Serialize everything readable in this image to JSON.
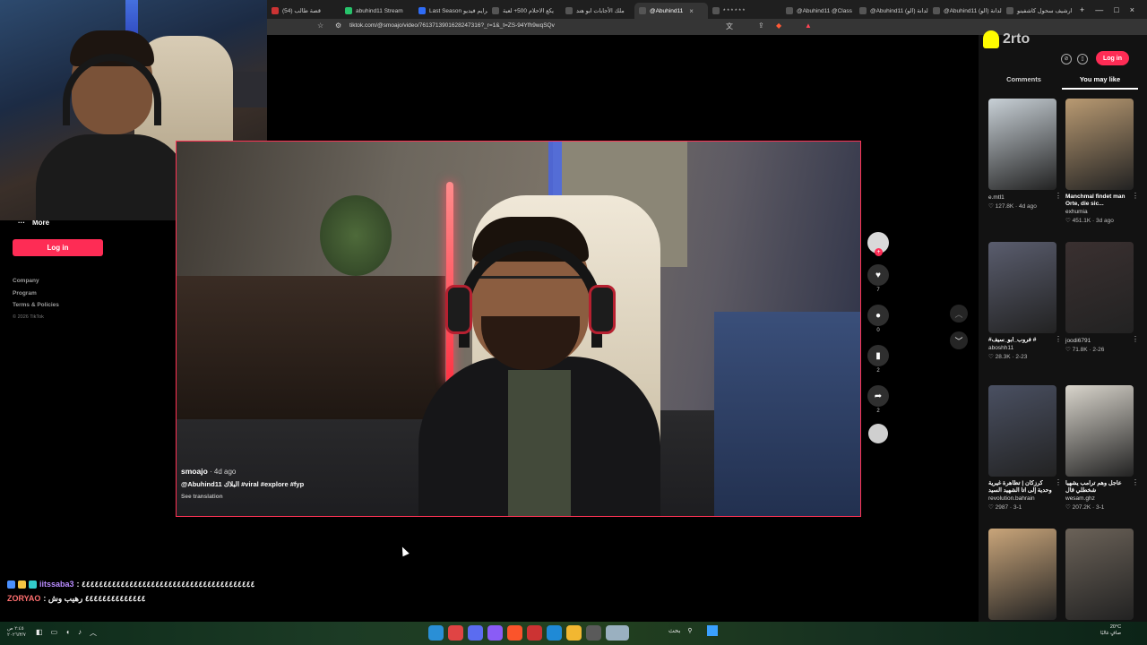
{
  "browser": {
    "tabs": [
      {
        "label": "(54) قصة طالب",
        "color": "#c33"
      },
      {
        "label": "abuhind11 Stream",
        "color": "#27c36b"
      },
      {
        "label": "Last Season برايم فيديو",
        "color": "#2f6cf6"
      },
      {
        "label": "يكع الاحلام 500+ لعبة",
        "color": "#555"
      },
      {
        "label": "ملك الأجابات ابو هند",
        "color": "#555"
      },
      {
        "label": "@Abuhind11",
        "color": "#555",
        "active": true
      },
      {
        "label": "* * * * * *",
        "color": "#555"
      },
      {
        "label": "@Abuhind11 @Class",
        "color": "#555"
      },
      {
        "label": "@Abuhind11 الدانة (الو)",
        "color": "#555"
      },
      {
        "label": "@Abuhind11 الدانة (الو)",
        "color": "#555"
      },
      {
        "label": "ارشيف سحول كاشفينو",
        "color": "#555"
      }
    ],
    "close_glyph": "×",
    "new_tab": "+",
    "window_controls": [
      "—",
      "□",
      "×"
    ],
    "url": "tiktok.com/@smoajo/video/7613713901628247316?_r=1&_t=ZS-94Yfh9wqSQv"
  },
  "sidebar": {
    "more_icon": "···",
    "more_label": "More",
    "login_label": "Log in",
    "links": [
      "Company",
      "Program",
      "Terms & Policies"
    ],
    "copyright": "© 2026 TikTok"
  },
  "video": {
    "author": "smoajo",
    "age": "4d ago",
    "description": "@Abuhind11 البلاك #viral #explore #fyp",
    "see_translation": "See translation"
  },
  "rail": {
    "plus": "+",
    "items": [
      {
        "name": "like-icon",
        "glyph": "♥",
        "count": "7"
      },
      {
        "name": "comment-icon",
        "glyph": "●",
        "count": "0"
      },
      {
        "name": "bookmark-icon",
        "glyph": "▮",
        "count": "2"
      },
      {
        "name": "share-icon",
        "glyph": "➦",
        "count": "2"
      }
    ]
  },
  "nav": {
    "up": "︿",
    "down": "﹀"
  },
  "right_panel": {
    "snap_text": "2rto",
    "icon_a": "⊘",
    "icon_b": "▯",
    "login_label": "Log in",
    "tab_comments": "Comments",
    "tab_you_may_like": "You may like",
    "cards": [
      {
        "title": "",
        "user": "e.mtl1",
        "meta": "♡ 127.8K · 4d ago",
        "color": "#c8d0d6"
      },
      {
        "title": "Manchmal findet man Orte, die sic...",
        "user": "exhumia",
        "meta": "♡ 451.1K · 3d ago",
        "color": "#b99a72"
      },
      {
        "title": "#فروب_ابو_سيف #",
        "user": "aboshh11",
        "meta": "♡ 28.3K · 2-23",
        "color": "#5a5d6e"
      },
      {
        "title": "",
        "user": "joodi6791",
        "meta": "♡ 71.8K · 2-26",
        "color": "#3a3030"
      },
      {
        "title": "كرزكان | تظاهرة غيرية وحدية إلى اتا الشهيد السيد",
        "user": "revolution.bahrain",
        "meta": "♡ 2987 · 3-1",
        "color": "#4a5062"
      },
      {
        "title": "عاجل وهم ترامب يشهيا شخطلي قال",
        "user": "wesam.ghz",
        "meta": "♡ 207.2K · 3-1",
        "color": "#d9d5cc"
      },
      {
        "title": "",
        "user": "",
        "meta": "",
        "color": "#c9a57a"
      },
      {
        "title": "",
        "user": "",
        "meta": "",
        "color": "#6b6258"
      }
    ]
  },
  "chat": [
    {
      "user": "iitssaba3",
      "message": ": ٤٤٤٤٤٤٤٤٤٤٤٤٤٤٤٤٤٤٤٤٤٤٤٤٤٤٤٤٤٤٤٤٤٤٤٤٤٤٤٤"
    },
    {
      "user": "ZORYAO",
      "message": ": ٤٤٤٤٤٤٤٤٤٤٤٤٤٤ رهيب وش"
    }
  ],
  "taskbar": {
    "time": "٢:٤٥ ص",
    "date": "٢٠٢٦/٣/٧",
    "search_text": "بحث",
    "weather": "20°C",
    "weather_desc": "صافٍ غالبًا"
  }
}
